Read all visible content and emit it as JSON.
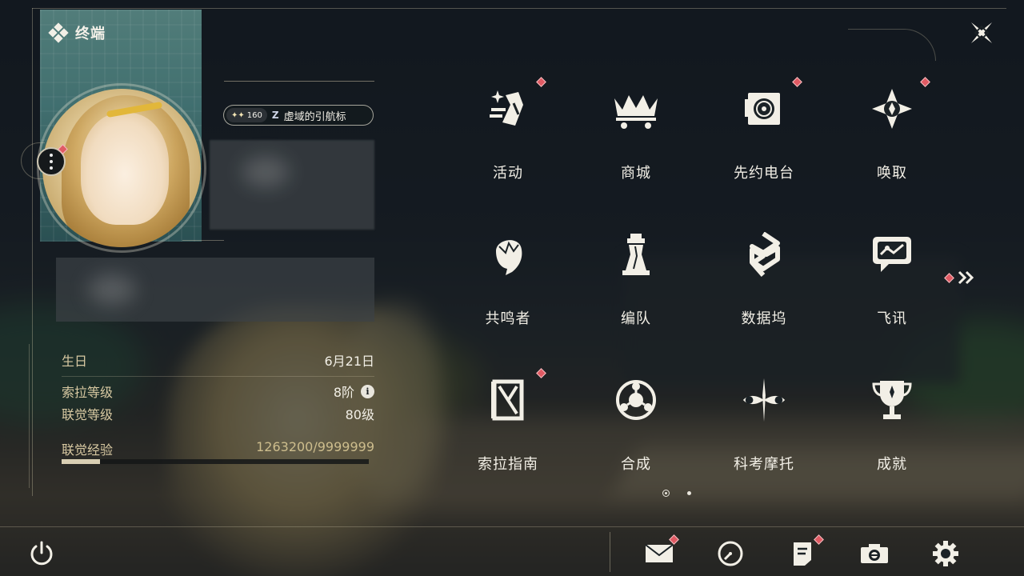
{
  "header": {
    "title": "终端"
  },
  "profile": {
    "level_badge": "160",
    "badge_symbol": "Z",
    "title_name": "虚域的引航标"
  },
  "stats": [
    {
      "label": "生日",
      "value": "6月21日"
    },
    {
      "label": "索拉等级",
      "value": "8阶"
    },
    {
      "label": "联觉等级",
      "value": "80级"
    }
  ],
  "experience": {
    "label": "联觉经验",
    "value": "1263200/9999999",
    "progress": 0.126
  },
  "grid": [
    {
      "label": "活动",
      "icon": "sparkle-activity-icon",
      "notify": true
    },
    {
      "label": "商城",
      "icon": "shop-cart-icon",
      "notify": false
    },
    {
      "label": "先约电台",
      "icon": "radio-player-icon",
      "notify": true
    },
    {
      "label": "唤取",
      "icon": "compass-star-icon",
      "notify": true
    },
    {
      "label": "共鸣者",
      "icon": "character-head-icon",
      "notify": false
    },
    {
      "label": "编队",
      "icon": "chess-piece-icon",
      "notify": false
    },
    {
      "label": "数据坞",
      "icon": "data-dock-icon",
      "notify": false
    },
    {
      "label": "飞讯",
      "icon": "chat-message-icon",
      "notify": false
    },
    {
      "label": "索拉指南",
      "icon": "guide-book-icon",
      "notify": true
    },
    {
      "label": "合成",
      "icon": "synthesis-ring-icon",
      "notify": false
    },
    {
      "label": "科考摩托",
      "icon": "motorbike-icon",
      "notify": false
    },
    {
      "label": "成就",
      "icon": "trophy-icon",
      "notify": false
    }
  ],
  "pager": {
    "pages": 2,
    "current": 1
  },
  "bottom_bar": [
    {
      "name": "mail",
      "icon": "mail-icon",
      "notify": true
    },
    {
      "name": "clock",
      "icon": "clock-icon",
      "notify": false
    },
    {
      "name": "notes",
      "icon": "notes-icon",
      "notify": true
    },
    {
      "name": "camera",
      "icon": "camera-icon",
      "notify": false
    },
    {
      "name": "settings",
      "icon": "gear-icon",
      "notify": false
    }
  ],
  "colors": {
    "accent": "#e05a63",
    "text": "#f2efe6",
    "label": "#d8c9a2"
  }
}
